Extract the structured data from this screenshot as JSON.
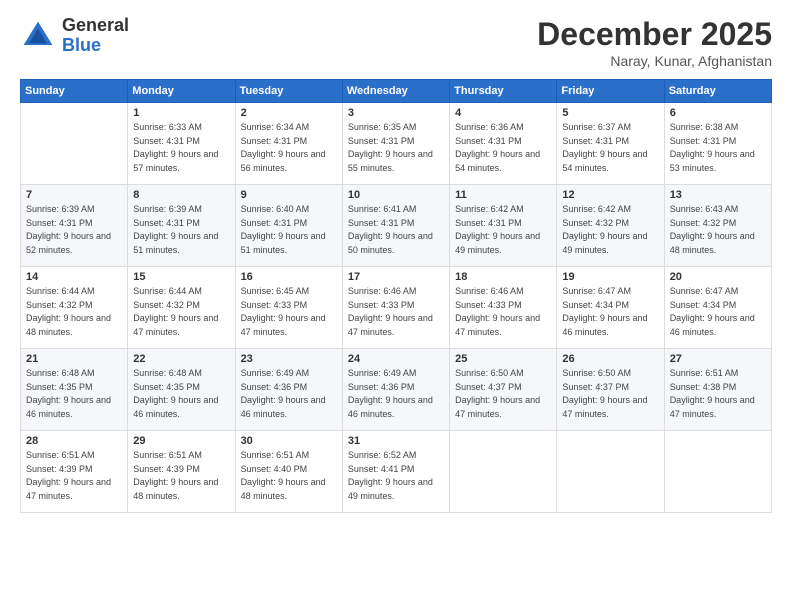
{
  "logo": {
    "general": "General",
    "blue": "Blue"
  },
  "title": "December 2025",
  "location": "Naray, Kunar, Afghanistan",
  "weekdays": [
    "Sunday",
    "Monday",
    "Tuesday",
    "Wednesday",
    "Thursday",
    "Friday",
    "Saturday"
  ],
  "weeks": [
    [
      {
        "day": "",
        "sunrise": "",
        "sunset": "",
        "daylight": ""
      },
      {
        "day": "1",
        "sunrise": "Sunrise: 6:33 AM",
        "sunset": "Sunset: 4:31 PM",
        "daylight": "Daylight: 9 hours and 57 minutes."
      },
      {
        "day": "2",
        "sunrise": "Sunrise: 6:34 AM",
        "sunset": "Sunset: 4:31 PM",
        "daylight": "Daylight: 9 hours and 56 minutes."
      },
      {
        "day": "3",
        "sunrise": "Sunrise: 6:35 AM",
        "sunset": "Sunset: 4:31 PM",
        "daylight": "Daylight: 9 hours and 55 minutes."
      },
      {
        "day": "4",
        "sunrise": "Sunrise: 6:36 AM",
        "sunset": "Sunset: 4:31 PM",
        "daylight": "Daylight: 9 hours and 54 minutes."
      },
      {
        "day": "5",
        "sunrise": "Sunrise: 6:37 AM",
        "sunset": "Sunset: 4:31 PM",
        "daylight": "Daylight: 9 hours and 54 minutes."
      },
      {
        "day": "6",
        "sunrise": "Sunrise: 6:38 AM",
        "sunset": "Sunset: 4:31 PM",
        "daylight": "Daylight: 9 hours and 53 minutes."
      }
    ],
    [
      {
        "day": "7",
        "sunrise": "Sunrise: 6:39 AM",
        "sunset": "Sunset: 4:31 PM",
        "daylight": "Daylight: 9 hours and 52 minutes."
      },
      {
        "day": "8",
        "sunrise": "Sunrise: 6:39 AM",
        "sunset": "Sunset: 4:31 PM",
        "daylight": "Daylight: 9 hours and 51 minutes."
      },
      {
        "day": "9",
        "sunrise": "Sunrise: 6:40 AM",
        "sunset": "Sunset: 4:31 PM",
        "daylight": "Daylight: 9 hours and 51 minutes."
      },
      {
        "day": "10",
        "sunrise": "Sunrise: 6:41 AM",
        "sunset": "Sunset: 4:31 PM",
        "daylight": "Daylight: 9 hours and 50 minutes."
      },
      {
        "day": "11",
        "sunrise": "Sunrise: 6:42 AM",
        "sunset": "Sunset: 4:31 PM",
        "daylight": "Daylight: 9 hours and 49 minutes."
      },
      {
        "day": "12",
        "sunrise": "Sunrise: 6:42 AM",
        "sunset": "Sunset: 4:32 PM",
        "daylight": "Daylight: 9 hours and 49 minutes."
      },
      {
        "day": "13",
        "sunrise": "Sunrise: 6:43 AM",
        "sunset": "Sunset: 4:32 PM",
        "daylight": "Daylight: 9 hours and 48 minutes."
      }
    ],
    [
      {
        "day": "14",
        "sunrise": "Sunrise: 6:44 AM",
        "sunset": "Sunset: 4:32 PM",
        "daylight": "Daylight: 9 hours and 48 minutes."
      },
      {
        "day": "15",
        "sunrise": "Sunrise: 6:44 AM",
        "sunset": "Sunset: 4:32 PM",
        "daylight": "Daylight: 9 hours and 47 minutes."
      },
      {
        "day": "16",
        "sunrise": "Sunrise: 6:45 AM",
        "sunset": "Sunset: 4:33 PM",
        "daylight": "Daylight: 9 hours and 47 minutes."
      },
      {
        "day": "17",
        "sunrise": "Sunrise: 6:46 AM",
        "sunset": "Sunset: 4:33 PM",
        "daylight": "Daylight: 9 hours and 47 minutes."
      },
      {
        "day": "18",
        "sunrise": "Sunrise: 6:46 AM",
        "sunset": "Sunset: 4:33 PM",
        "daylight": "Daylight: 9 hours and 47 minutes."
      },
      {
        "day": "19",
        "sunrise": "Sunrise: 6:47 AM",
        "sunset": "Sunset: 4:34 PM",
        "daylight": "Daylight: 9 hours and 46 minutes."
      },
      {
        "day": "20",
        "sunrise": "Sunrise: 6:47 AM",
        "sunset": "Sunset: 4:34 PM",
        "daylight": "Daylight: 9 hours and 46 minutes."
      }
    ],
    [
      {
        "day": "21",
        "sunrise": "Sunrise: 6:48 AM",
        "sunset": "Sunset: 4:35 PM",
        "daylight": "Daylight: 9 hours and 46 minutes."
      },
      {
        "day": "22",
        "sunrise": "Sunrise: 6:48 AM",
        "sunset": "Sunset: 4:35 PM",
        "daylight": "Daylight: 9 hours and 46 minutes."
      },
      {
        "day": "23",
        "sunrise": "Sunrise: 6:49 AM",
        "sunset": "Sunset: 4:36 PM",
        "daylight": "Daylight: 9 hours and 46 minutes."
      },
      {
        "day": "24",
        "sunrise": "Sunrise: 6:49 AM",
        "sunset": "Sunset: 4:36 PM",
        "daylight": "Daylight: 9 hours and 46 minutes."
      },
      {
        "day": "25",
        "sunrise": "Sunrise: 6:50 AM",
        "sunset": "Sunset: 4:37 PM",
        "daylight": "Daylight: 9 hours and 47 minutes."
      },
      {
        "day": "26",
        "sunrise": "Sunrise: 6:50 AM",
        "sunset": "Sunset: 4:37 PM",
        "daylight": "Daylight: 9 hours and 47 minutes."
      },
      {
        "day": "27",
        "sunrise": "Sunrise: 6:51 AM",
        "sunset": "Sunset: 4:38 PM",
        "daylight": "Daylight: 9 hours and 47 minutes."
      }
    ],
    [
      {
        "day": "28",
        "sunrise": "Sunrise: 6:51 AM",
        "sunset": "Sunset: 4:39 PM",
        "daylight": "Daylight: 9 hours and 47 minutes."
      },
      {
        "day": "29",
        "sunrise": "Sunrise: 6:51 AM",
        "sunset": "Sunset: 4:39 PM",
        "daylight": "Daylight: 9 hours and 48 minutes."
      },
      {
        "day": "30",
        "sunrise": "Sunrise: 6:51 AM",
        "sunset": "Sunset: 4:40 PM",
        "daylight": "Daylight: 9 hours and 48 minutes."
      },
      {
        "day": "31",
        "sunrise": "Sunrise: 6:52 AM",
        "sunset": "Sunset: 4:41 PM",
        "daylight": "Daylight: 9 hours and 49 minutes."
      },
      {
        "day": "",
        "sunrise": "",
        "sunset": "",
        "daylight": ""
      },
      {
        "day": "",
        "sunrise": "",
        "sunset": "",
        "daylight": ""
      },
      {
        "day": "",
        "sunrise": "",
        "sunset": "",
        "daylight": ""
      }
    ]
  ]
}
